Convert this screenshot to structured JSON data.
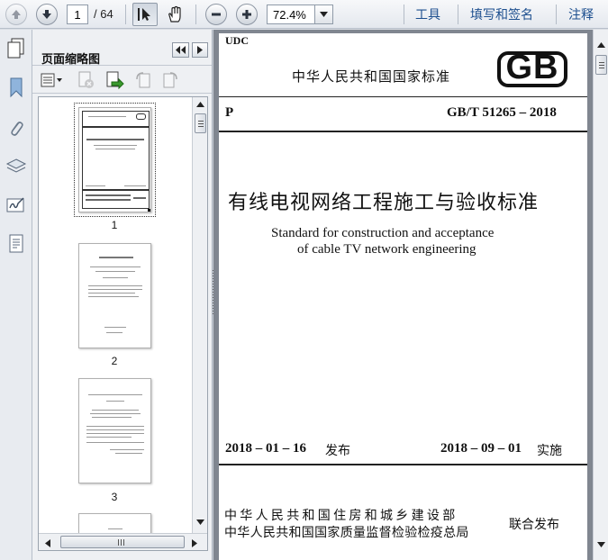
{
  "toolbar": {
    "page_current": "1",
    "page_total": "/ 64",
    "zoom": "72.4%",
    "tools_label": "工具",
    "fill_sign_label": "填写和签名",
    "comment_label": "注释"
  },
  "panel": {
    "title": "页面缩略图",
    "thumbnails": [
      {
        "number": "1"
      },
      {
        "number": "2"
      },
      {
        "number": "3"
      }
    ]
  },
  "document": {
    "udc": "UDC",
    "national_standard": "中华人民共和国国家标准",
    "logo": "GB",
    "category": "P",
    "code": "GB/T 51265 – 2018",
    "title_cn": "有线电视网络工程施工与验收标准",
    "title_en_line1": "Standard for construction and  acceptance",
    "title_en_line2": "of cable TV network engineering",
    "issue_date": "2018 – 01 – 16",
    "issue_label": "发布",
    "effective_date": "2018 – 09 – 01",
    "effective_label": "实施",
    "publisher1": "中华人民共和国住房和城乡建设部",
    "publisher2": "中华人民共和国国家质量监督检验检疫总局",
    "joint_release": "联合发布"
  }
}
